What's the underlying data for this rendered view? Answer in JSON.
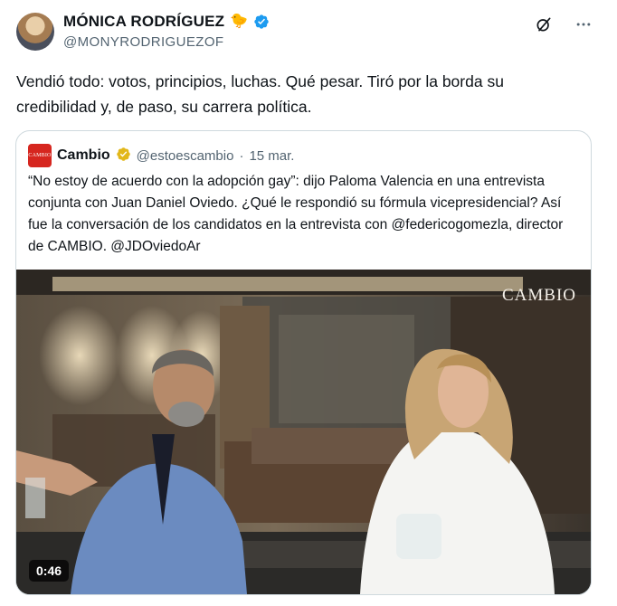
{
  "author": {
    "display_name": "MÓNICA RODRÍGUEZ",
    "emoji": "🐤",
    "handle": "@MONYRODRIGUEZOF",
    "verified_color": "#1d9bf0"
  },
  "top_actions": {
    "grok_icon": "grok-icon",
    "more_icon": "more-icon"
  },
  "tweet": {
    "text": "Vendió todo: votos, principios, luchas. Qué pesar. Tiró por la borda su credibilidad y, de paso, su carrera política."
  },
  "quoted": {
    "logo_text": "CAMBIO",
    "name": "Cambio",
    "verified_color": "#e2b719",
    "handle": "@estoescambio",
    "separator": "·",
    "date": "15 mar.",
    "text": "“No estoy de acuerdo con la adopción gay”: dijo Paloma Valencia en una entrevista conjunta con Juan Daniel Oviedo. ¿Qué le respondió su fórmula vicepresidencial? Así fue la conversación de los candidatos en la entrevista con @federicogomezla, director de CAMBIO. @JDOviedoAr",
    "video": {
      "watermark": "CAMBIO",
      "duration": "0:46"
    }
  }
}
